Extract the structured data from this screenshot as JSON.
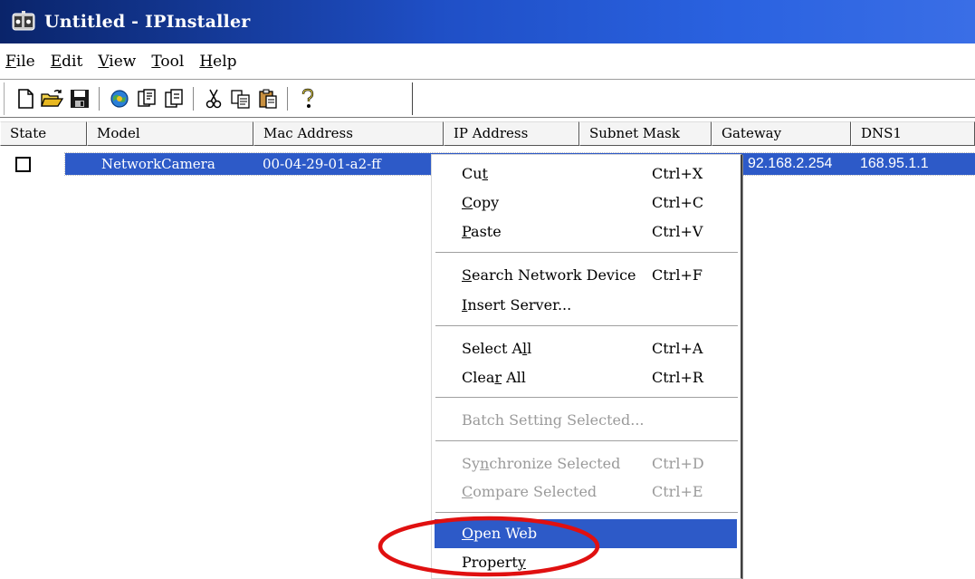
{
  "window": {
    "title": "Untitled - IPInstaller"
  },
  "menubar": {
    "items": [
      {
        "label": "File",
        "mnemonic": "F"
      },
      {
        "label": "Edit",
        "mnemonic": "E"
      },
      {
        "label": "View",
        "mnemonic": "V"
      },
      {
        "label": "Tool",
        "mnemonic": "T"
      },
      {
        "label": "Help",
        "mnemonic": "H"
      }
    ]
  },
  "toolbar": {
    "buttons": [
      {
        "name": "new-file-icon"
      },
      {
        "name": "open-folder-icon"
      },
      {
        "name": "save-icon"
      },
      {
        "name": "search-network-icon"
      },
      {
        "name": "insert-server-icon"
      },
      {
        "name": "property-icon"
      },
      {
        "name": "cut-icon"
      },
      {
        "name": "copy-icon"
      },
      {
        "name": "paste-icon"
      },
      {
        "name": "help-icon"
      }
    ]
  },
  "list": {
    "columns": [
      "State",
      "Model",
      "Mac Address",
      "IP Address",
      "Subnet Mask",
      "Gateway",
      "DNS1"
    ],
    "rows": [
      {
        "state": "unchecked",
        "model": "NetworkCamera",
        "mac": "00-04-29-01-a2-ff",
        "gateway": "92.168.2.254",
        "dns1": "168.95.1.1"
      }
    ]
  },
  "context_menu": {
    "items": [
      {
        "label_pre": "Cu",
        "label_u": "t",
        "label_post": "",
        "shortcut": "Ctrl+X",
        "disabled": false
      },
      {
        "label_pre": "",
        "label_u": "C",
        "label_post": "opy",
        "shortcut": "Ctrl+C",
        "disabled": false
      },
      {
        "label_pre": "",
        "label_u": "P",
        "label_post": "aste",
        "shortcut": "Ctrl+V",
        "disabled": false
      },
      {
        "label_pre": "",
        "label_u": "S",
        "label_post": "earch Network Device",
        "shortcut": "Ctrl+F",
        "disabled": false
      },
      {
        "label_pre": "",
        "label_u": "I",
        "label_post": "nsert Server...",
        "shortcut": "",
        "disabled": false
      },
      {
        "label_pre": "Select A",
        "label_u": "l",
        "label_post": "l",
        "shortcut": "Ctrl+A",
        "disabled": false
      },
      {
        "label_pre": "Clea",
        "label_u": "r",
        "label_post": " All",
        "shortcut": "Ctrl+R",
        "disabled": false
      },
      {
        "label_pre": "Batch Setting Selected...",
        "label_u": "",
        "label_post": "",
        "shortcut": "",
        "disabled": true
      },
      {
        "label_pre": "Sy",
        "label_u": "n",
        "label_post": "chronize Selected",
        "shortcut": "Ctrl+D",
        "disabled": true
      },
      {
        "label_pre": "",
        "label_u": "C",
        "label_post": "ompare Selected",
        "shortcut": "Ctrl+E",
        "disabled": true
      },
      {
        "label_pre": "",
        "label_u": "O",
        "label_post": "pen Web",
        "shortcut": "",
        "disabled": false,
        "highlighted": true
      },
      {
        "label_pre": "Propert",
        "label_u": "y",
        "label_post": "",
        "shortcut": "",
        "disabled": false
      }
    ]
  },
  "colors": {
    "selection": "#2d5ac8",
    "annotation": "#e01010"
  }
}
